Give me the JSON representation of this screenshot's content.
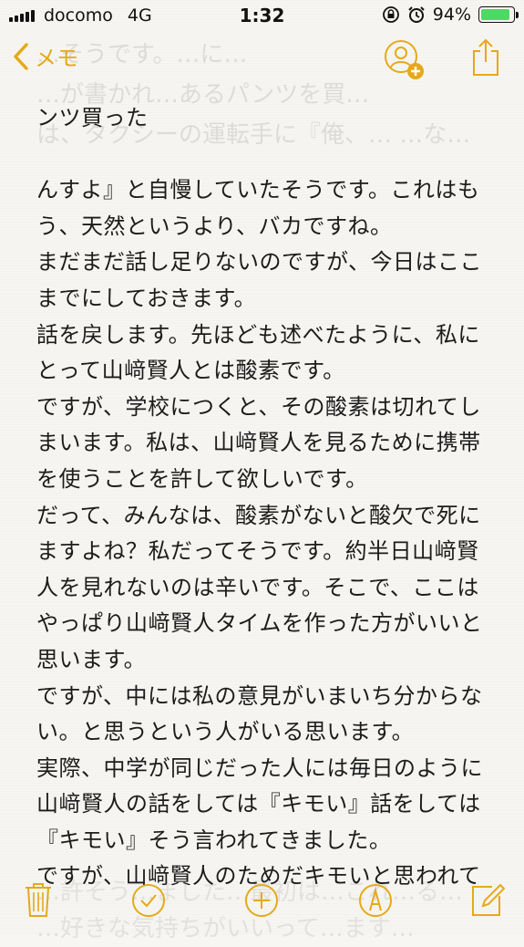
{
  "status_bar": {
    "carrier": "docomo",
    "network": "4G",
    "time": "1:32",
    "battery_percent": "94%",
    "battery_level": 0.94
  },
  "nav": {
    "back_label": "メモ",
    "accent_color": "#e5a91a"
  },
  "ghost_top": [
    "…そうです。…に…",
    "…が書かれ…あるパンツを買…",
    "は、タクシーの運転手に『俺、… …な…"
  ],
  "note_lines": [
    "ンツ買った",
    "",
    "んすよ』と自慢していたそうです。これはも",
    "う、天然というより、バカですね。",
    "まだまだ話し足りないのですが、今日はここ",
    "までにしておきます。",
    "話を戻します。先ほども述べたように、私に",
    "とって山﨑賢人とは酸素です。",
    "ですが、学校につくと、その酸素は切れてし",
    "まいます。私は、山﨑賢人を見るために携帯",
    "を使うことを許して欲しいです。",
    "だって、みんなは、酸素がないと酸欠で死に",
    "ますよね？私だってそうです。約半日山﨑賢",
    "人を見れないのは辛いです。そこで、ここは",
    "やっぱり山﨑賢人タイムを作った方がいいと",
    "思います。",
    "ですが、中には私の意見がいまいち分からな",
    "い。と思うという人がいる思います。",
    "実際、中学が同じだった人には毎日のように",
    "山﨑賢人の話をしては『キモい』話をしては",
    "『キモい』そう言われてきました。",
    "ですが、山﨑賢人のためだキモいと思われて"
  ],
  "ghost_bottom": [
    "…許そう…ました…最初は…これ…る…",
    "…好きな気持ちがいいって…ます…"
  ],
  "toolbar": {
    "icons": [
      "trash-icon",
      "checklist-icon",
      "add-icon",
      "sketch-icon",
      "compose-icon"
    ]
  }
}
